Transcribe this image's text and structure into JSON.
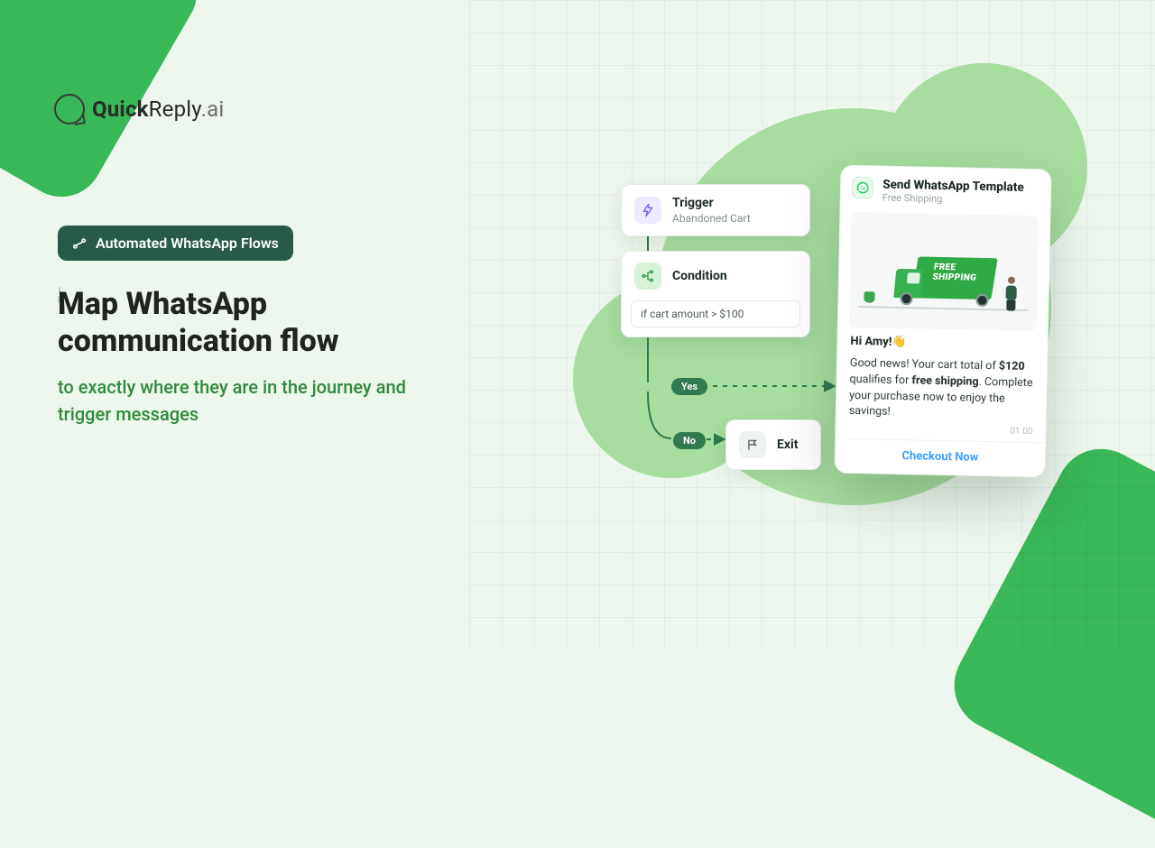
{
  "brand": {
    "name_html": "QuickReply.ai"
  },
  "hero": {
    "pill": "Automated WhatsApp Flows",
    "headline": "Map WhatsApp communication flow",
    "subhead": "to exactly where they are in the journey and trigger messages"
  },
  "flow": {
    "trigger": {
      "title": "Trigger",
      "subtitle": "Abandoned Cart"
    },
    "condition": {
      "title": "Condition",
      "expr": "if cart amount > $100"
    },
    "exit": {
      "title": "Exit"
    },
    "yes": "Yes",
    "no": "No"
  },
  "template": {
    "title": "Send WhatsApp Template",
    "subtitle": "Free Shipping",
    "truck_text": "FREE\nSHIPPING",
    "salutation": "Hi Amy!",
    "wave": "👋",
    "body_pre": "Good news! Your cart total of ",
    "amount": "$120",
    "body_mid": " qualifies for ",
    "freeship": "free shipping",
    "body_post": ". Complete your purchase now to enjoy the savings!",
    "time": "01.00",
    "cta": "Checkout Now"
  }
}
